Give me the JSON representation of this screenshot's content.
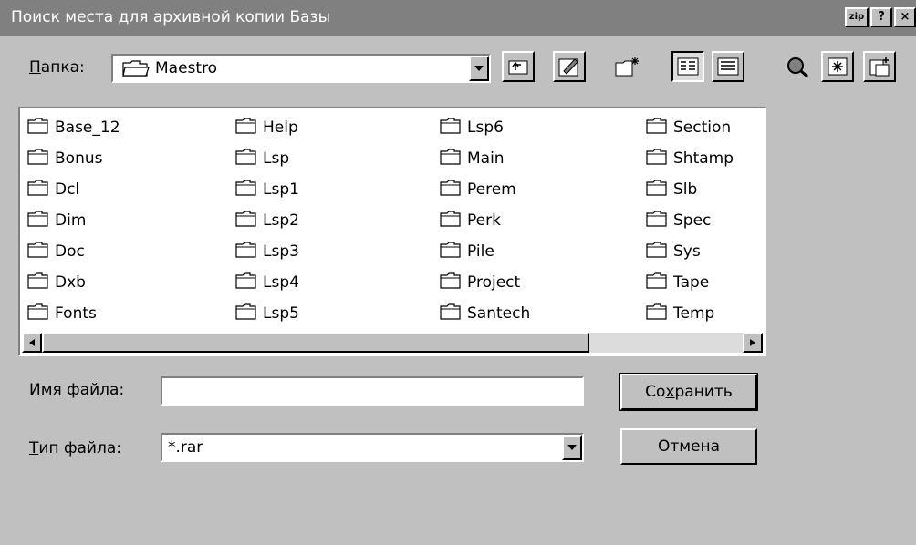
{
  "window": {
    "title": "Поиск места для архивной копии Базы",
    "caption_buttons": [
      {
        "name": "zip-button",
        "label": "zip"
      },
      {
        "name": "help-button",
        "label": "?"
      },
      {
        "name": "close-button",
        "label": "×"
      }
    ]
  },
  "lookin": {
    "label_prefix": "П",
    "label_rest": "апка:",
    "value": "Maestro",
    "icon": "open-folder-icon"
  },
  "toolbar": {
    "icons": [
      "up-folder-icon",
      "edit-icon",
      "new-folder-icon",
      "list-view-icon",
      "details-view-icon",
      "search-icon",
      "star-icon",
      "add-folder-icon"
    ]
  },
  "folders": [
    [
      "Base_12",
      "Bonus",
      "Dcl",
      "Dim",
      "Doc",
      "Dxb",
      "Fonts"
    ],
    [
      "Help",
      "Lsp",
      "Lsp1",
      "Lsp2",
      "Lsp3",
      "Lsp4",
      "Lsp5"
    ],
    [
      "Lsp6",
      "Main",
      "Perem",
      "Perk",
      "Pile",
      "Project",
      "Santech"
    ],
    [
      "Section",
      "Shtamp",
      "Slb",
      "Spec",
      "Sys",
      "Tape",
      "Temp"
    ]
  ],
  "filename": {
    "label_prefix": "И",
    "label_rest": "мя файла:",
    "value": ""
  },
  "filetype": {
    "label_prefix": "Т",
    "label_rest": "ип файла:",
    "value": "*.rar"
  },
  "buttons": {
    "save_a": "Со",
    "save_u": "х",
    "save_b": "ранить",
    "cancel": "Отмена"
  }
}
